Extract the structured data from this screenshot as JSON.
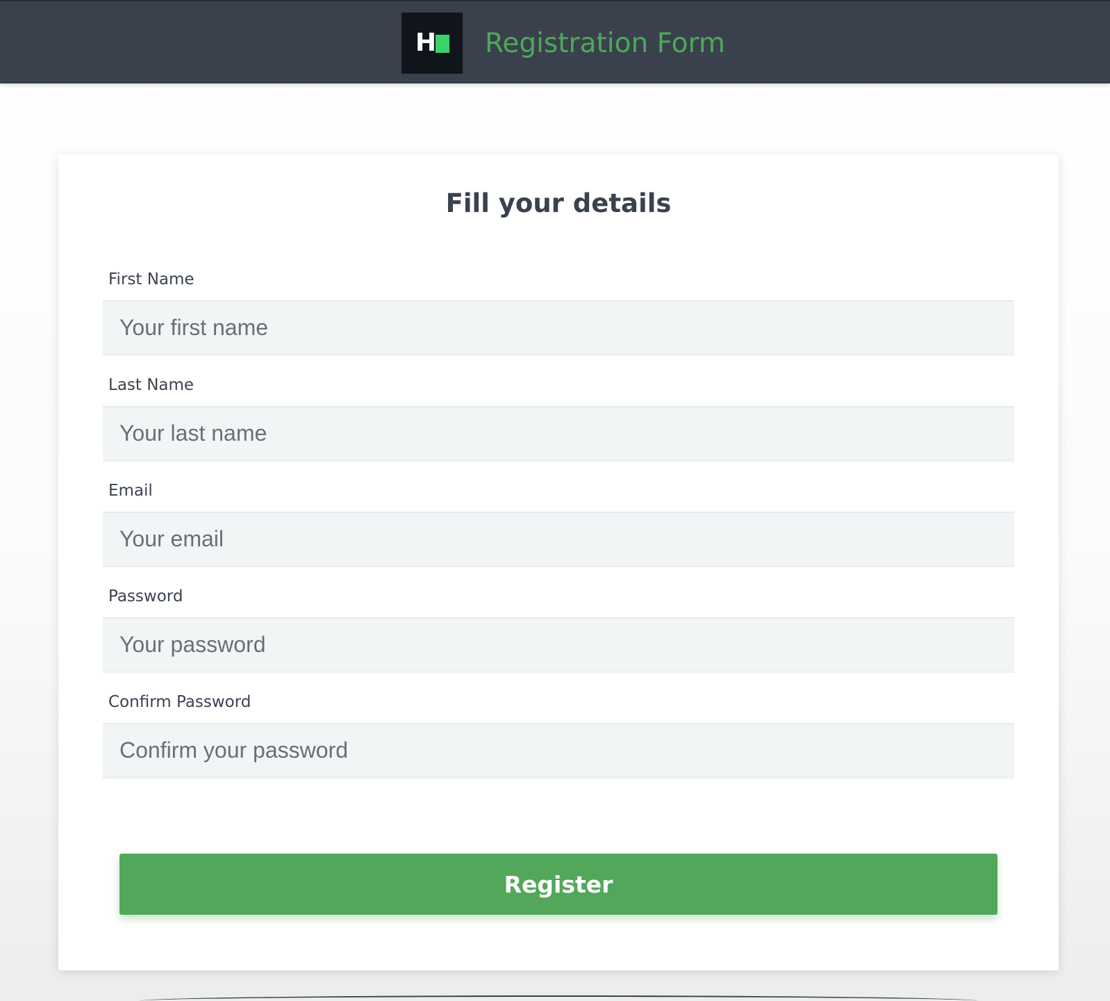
{
  "header": {
    "logo_letter": "H",
    "title": "Registration Form"
  },
  "form": {
    "heading": "Fill your details",
    "fields": [
      {
        "label": "First Name",
        "placeholder": "Your first name"
      },
      {
        "label": "Last Name",
        "placeholder": "Your last name"
      },
      {
        "label": "Email",
        "placeholder": "Your email"
      },
      {
        "label": "Password",
        "placeholder": "Your password"
      },
      {
        "label": "Confirm Password",
        "placeholder": "Confirm your password"
      }
    ],
    "submit_label": "Register"
  },
  "colors": {
    "header_bg": "#3a414c",
    "accent_green": "#52a75a",
    "title_green": "#4ea859",
    "logo_bg": "#10151c",
    "logo_block": "#39d36a",
    "input_bg": "#f2f5f6",
    "text_dark": "#39424e"
  },
  "icons": {
    "logo": "hackerrank-logo-icon"
  }
}
